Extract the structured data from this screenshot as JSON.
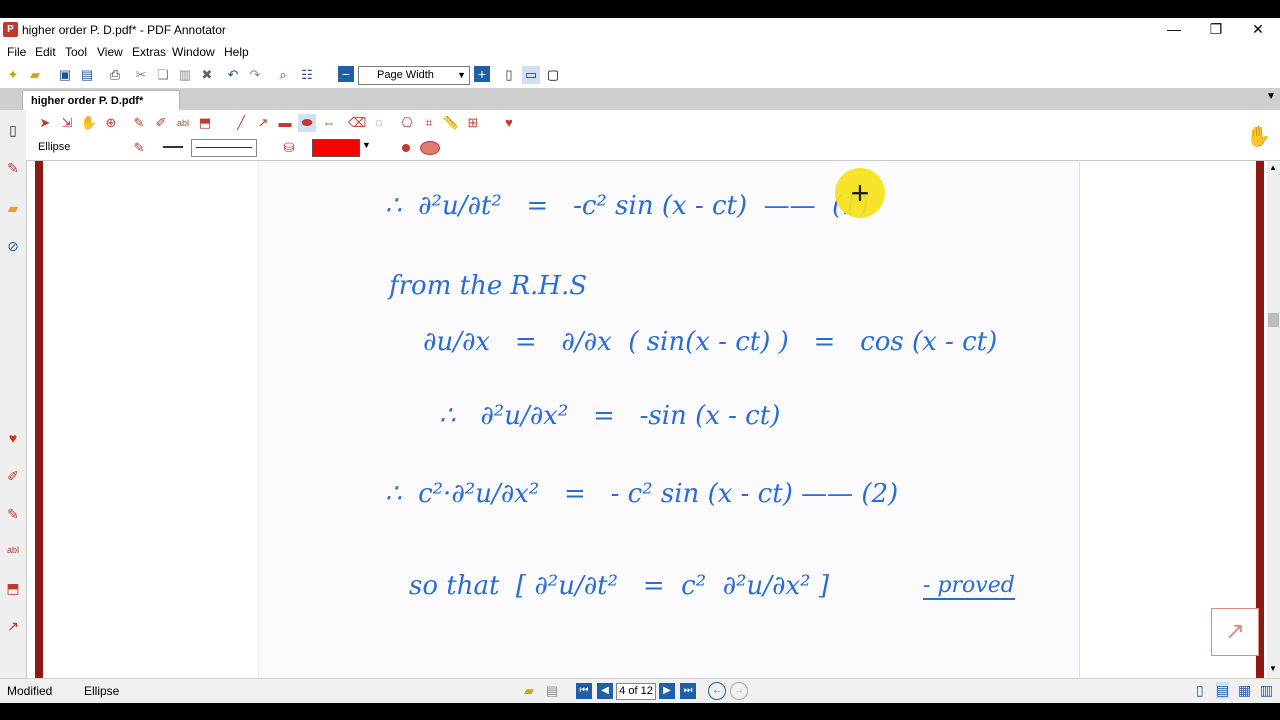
{
  "window": {
    "title": "higher order P. D.pdf* - PDF Annotator",
    "app_icon": "pdf-annotator-icon"
  },
  "menu": [
    "File",
    "Edit",
    "Tool",
    "View",
    "Extras",
    "Window",
    "Help"
  ],
  "toolbar": {
    "zoom_label": "Page Width"
  },
  "tab": {
    "label": "higher order P. D.pdf*"
  },
  "annot": {
    "tool_name": "Ellipse",
    "color": "#ff0000"
  },
  "document": {
    "lines": [
      "∴  ∂²u/∂t²   =   -c² sin (x - ct)  ——  (1)",
      "from the R.H.S",
      "∂u/∂x   =   ∂/∂x  ( sin(x - ct) )   =   cos (x - ct)",
      "∴   ∂²u/∂x²   =   -sin (x - ct)",
      "∴  c²·∂²u/∂x²   =   - c² sin (x - ct) —— (2)",
      "so that  [ ∂²u/∂t²   =  c²  ∂²u/∂x² ]",
      "- proved"
    ]
  },
  "status": {
    "left": "Modified",
    "tool": "Ellipse",
    "page": "4 of 12"
  }
}
